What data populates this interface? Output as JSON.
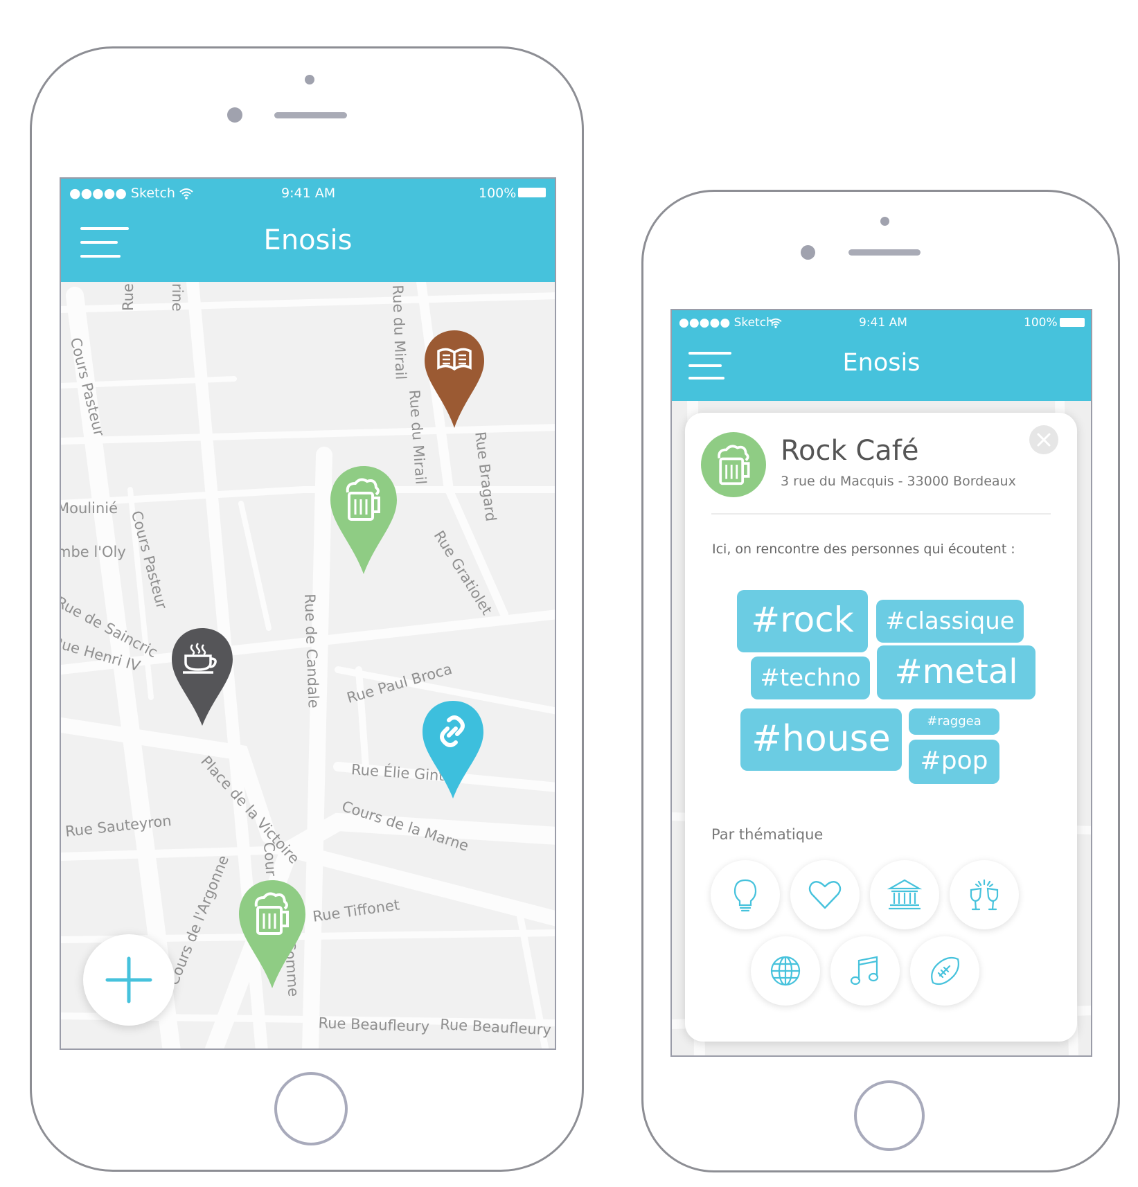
{
  "status_bar": {
    "carrier": "●●●●● Sketch",
    "time": "9:41 AM",
    "battery": "100%"
  },
  "app": {
    "title": "Enosis"
  },
  "map": {
    "streets": [
      "Rue",
      "rine",
      "Rue du Mirail",
      "Cours Pasteur",
      "Rue du Mirail",
      "Rue Bragard",
      "Moulinié",
      "mbe l'Oly",
      "Cours Pasteur",
      "Rue Gratiolet",
      "Rue de Saincric",
      "Rue Henri IV",
      "Rue de Candale",
      "Rue Paul Broca",
      "Rue Élie Gint",
      "Rue Sauteyron",
      "Place de la Victoire",
      "Cours de la Marne",
      "Cour",
      "Cours de l'Argonne",
      "Rue Tiffonet",
      "Comme",
      "Rue Beaufleury",
      "Rue Beaufleury"
    ],
    "pins": [
      {
        "kind": "book",
        "color": "#9b5a33"
      },
      {
        "kind": "beer",
        "color": "#8fcc84"
      },
      {
        "kind": "coffee",
        "color": "#555558"
      },
      {
        "kind": "link",
        "color": "#3dbfdd"
      },
      {
        "kind": "beer",
        "color": "#8fcc84"
      }
    ],
    "add_icon": "plus-icon"
  },
  "detail": {
    "place_name": "Rock Café",
    "address": "3 rue du Macquis - 33000 Bordeaux",
    "intro": "Ici, on rencontre des personnes qui écoutent :",
    "tags": [
      "#rock",
      "#classique",
      "#techno",
      "#metal",
      "#house",
      "#raggea",
      "#pop"
    ],
    "themes_label": "Par thématique",
    "themes": [
      "lightbulb-icon",
      "heart-icon",
      "museum-icon",
      "cheers-icon",
      "globe-icon",
      "music-icon",
      "football-icon"
    ],
    "accent": "#46c2dc"
  }
}
